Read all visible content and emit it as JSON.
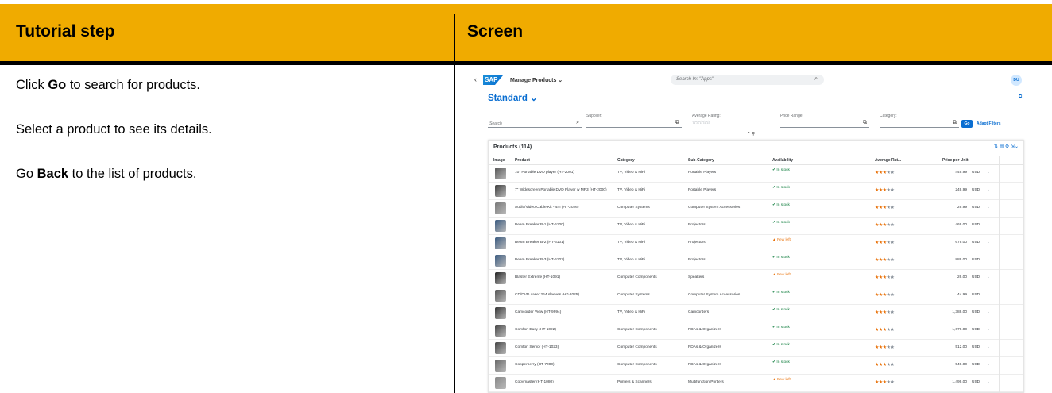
{
  "headers": {
    "step": "Tutorial step",
    "screen": "Screen"
  },
  "steps": [
    {
      "pre": "Click ",
      "bold": "Go",
      "post": " to search for products."
    },
    {
      "pre": "Select a product to see its details.",
      "bold": "",
      "post": ""
    },
    {
      "pre": "Go ",
      "bold": "Back",
      "post": " to the list of products."
    }
  ],
  "shell": {
    "back": "‹",
    "logo": "SAP",
    "app_title": "Manage Products ⌄",
    "search_placeholder": "Search In: \"Apps\"",
    "avatar": "DU"
  },
  "variant": "Standard ⌄",
  "filters": {
    "search_placeholder": "Search",
    "supplier_label": "Supplier:",
    "rating_label": "Average Rating:",
    "rating_stars": "☆☆☆☆☆",
    "price_label": "Price Range:",
    "category_label": "Category:",
    "go": "Go",
    "adapt": "Adapt Filters"
  },
  "table": {
    "title": "Products (114)",
    "columns": [
      "Image",
      "Product",
      "Category",
      "Sub-Category",
      "Availability",
      "Average Rat...",
      "Price per Unit"
    ],
    "rows": [
      {
        "product": "10\" Portable DVD player (HT-2001)",
        "category": "TV, Video & HiFi",
        "sub": "Portable Players",
        "avail": "In stock",
        "status": "ok",
        "rating": 3,
        "price": "449.99",
        "cur": "USD"
      },
      {
        "product": "7\" Widescreen Portable DVD Player w MP3 (HT-2000)",
        "category": "TV, Video & HiFi",
        "sub": "Portable Players",
        "avail": "In stock",
        "status": "ok",
        "rating": 3,
        "price": "249.99",
        "cur": "USD"
      },
      {
        "product": "Audio/Video Cable Kit - 4m (HT-2026)",
        "category": "Computer Systems",
        "sub": "Computer System Accessories",
        "avail": "In stock",
        "status": "ok",
        "rating": 3,
        "price": "29.99",
        "cur": "USD"
      },
      {
        "product": "Beam Breaker B-1 (HT-6100)",
        "category": "TV, Video & HiFi",
        "sub": "Projectors",
        "avail": "In stock",
        "status": "ok",
        "rating": 3,
        "price": "469.00",
        "cur": "USD"
      },
      {
        "product": "Beam Breaker B-2 (HT-6101)",
        "category": "TV, Video & HiFi",
        "sub": "Projectors",
        "avail": "Few left",
        "status": "few",
        "rating": 3,
        "price": "679.00",
        "cur": "USD"
      },
      {
        "product": "Beam Breaker B-3 (HT-6102)",
        "category": "TV, Video & HiFi",
        "sub": "Projectors",
        "avail": "In stock",
        "status": "ok",
        "rating": 3,
        "price": "889.00",
        "cur": "USD"
      },
      {
        "product": "Blaster Extreme (HT-1091)",
        "category": "Computer Components",
        "sub": "Speakers",
        "avail": "Few left",
        "status": "few",
        "rating": 3,
        "price": "26.00",
        "cur": "USD"
      },
      {
        "product": "CD/DVD case: 264 sleeves (HT-2025)",
        "category": "Computer Systems",
        "sub": "Computer System Accessories",
        "avail": "In stock",
        "status": "ok",
        "rating": 3,
        "price": "44.99",
        "cur": "USD"
      },
      {
        "product": "Camcorder View (HT-9994)",
        "category": "TV, Video & HiFi",
        "sub": "Camcorders",
        "avail": "In stock",
        "status": "ok",
        "rating": 3,
        "price": "1,388.00",
        "cur": "USD"
      },
      {
        "product": "Comfort Easy (HT-1022)",
        "category": "Computer Components",
        "sub": "PDAs & Organizers",
        "avail": "In stock",
        "status": "ok",
        "rating": 3,
        "price": "1,679.00",
        "cur": "USD"
      },
      {
        "product": "Comfort Senior (HT-1023)",
        "category": "Computer Components",
        "sub": "PDAs & Organizers",
        "avail": "In stock",
        "status": "ok",
        "rating": 3,
        "price": "512.00",
        "cur": "USD"
      },
      {
        "product": "Copperberry (HT-7000)",
        "category": "Computer Components",
        "sub": "PDAs & Organizers",
        "avail": "In stock",
        "status": "ok",
        "rating": 3,
        "price": "549.00",
        "cur": "USD"
      },
      {
        "product": "Copymaster (HT-1080)",
        "category": "Printers & Scanners",
        "sub": "Multifunction Printers",
        "avail": "Few left",
        "status": "few",
        "rating": 3,
        "price": "1,499.00",
        "cur": "USD"
      }
    ]
  },
  "colors": {
    "header_bg": "#f0ab00",
    "accent": "#0a6ed1",
    "ok": "#107e3e",
    "warn": "#e9730c"
  }
}
